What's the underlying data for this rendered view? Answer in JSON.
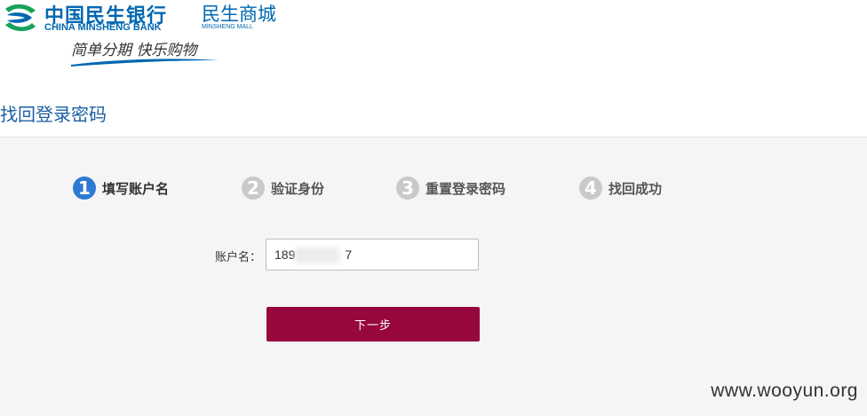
{
  "header": {
    "bank_name_cn": "中国民生银行",
    "bank_name_en": "CHINA MINSHENG BANK",
    "mall_name_cn": "民生商城",
    "mall_name_en": "MINSHENG MALL",
    "slogan": "简单分期 快乐购物",
    "logo_icon": "minsheng-logo-icon",
    "brand_color": "#0067b1"
  },
  "page": {
    "title": "找回登录密码"
  },
  "steps": [
    {
      "number": "1",
      "label": "填写账户名",
      "active": true
    },
    {
      "number": "2",
      "label": "验证身份",
      "active": false
    },
    {
      "number": "3",
      "label": "重置登录密码",
      "active": false
    },
    {
      "number": "4",
      "label": "找回成功",
      "active": false
    }
  ],
  "form": {
    "account_label": "账户名：",
    "account_value_prefix": "189",
    "account_value_suffix": "7",
    "next_button_label": "下一步",
    "button_color": "#97063c",
    "active_step_color": "#2e7ad2"
  },
  "watermark": "www.wooyun.org"
}
